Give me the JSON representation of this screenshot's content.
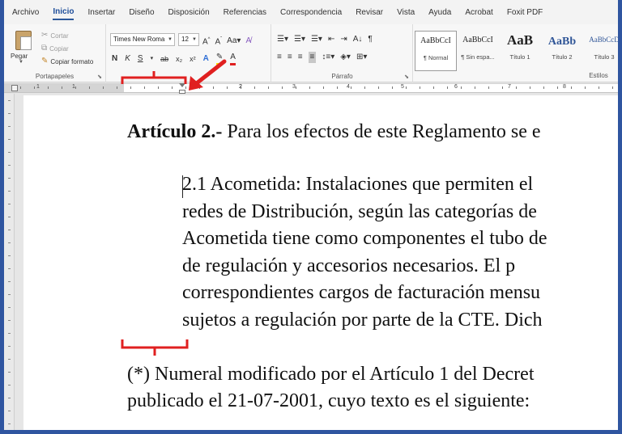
{
  "tabs": [
    "Archivo",
    "Inicio",
    "Insertar",
    "Diseño",
    "Disposición",
    "Referencias",
    "Correspondencia",
    "Revisar",
    "Vista",
    "Ayuda",
    "Acrobat",
    "Foxit PDF"
  ],
  "active_tab": "Inicio",
  "clipboard": {
    "paste_label": "Pegar",
    "cut_label": "Cortar",
    "copy_label": "Copiar",
    "format_painter_label": "Copiar formato",
    "group_label": "Portapapeles"
  },
  "font": {
    "family": "Times New Roma",
    "size": "12",
    "group_label": "Fuente"
  },
  "paragraph": {
    "group_label": "Párrafo"
  },
  "styles": {
    "group_label": "Estilos",
    "tiles": [
      {
        "sample": "AaBbCcI",
        "name": "¶ Normal"
      },
      {
        "sample": "AaBbCcI",
        "name": "¶ Sin espa..."
      },
      {
        "sample": "AaB",
        "name": "Título 1"
      },
      {
        "sample": "AaBb",
        "name": "Título 2"
      },
      {
        "sample": "AaBbCcD",
        "name": "Título 3"
      }
    ]
  },
  "ruler": {
    "numbers": [
      "1",
      "1",
      "2",
      "1",
      "1",
      "2",
      "3",
      "4",
      "5",
      "6",
      "7",
      "8"
    ]
  },
  "document": {
    "heading_bold": "Artículo 2.-",
    "heading_rest": " Para los efectos de este Reglamento se e",
    "lines": [
      "2.1 Acometida: Instalaciones que permiten el",
      "redes de Distribución, según las categorías de",
      "Acometida tiene como componentes el tubo de",
      "de regulación y accesorios necesarios. El p",
      "correspondientes cargos de facturación mensu",
      "sujetos a regulación por parte de la CTE. Dich"
    ],
    "note_lines": [
      "(*) Numeral modificado por el Artículo 1 del Decret",
      "publicado el 21-07-2001, cuyo texto es el siguiente:"
    ]
  },
  "colors": {
    "accent": "#2b579a",
    "annotation": "#e02020"
  }
}
